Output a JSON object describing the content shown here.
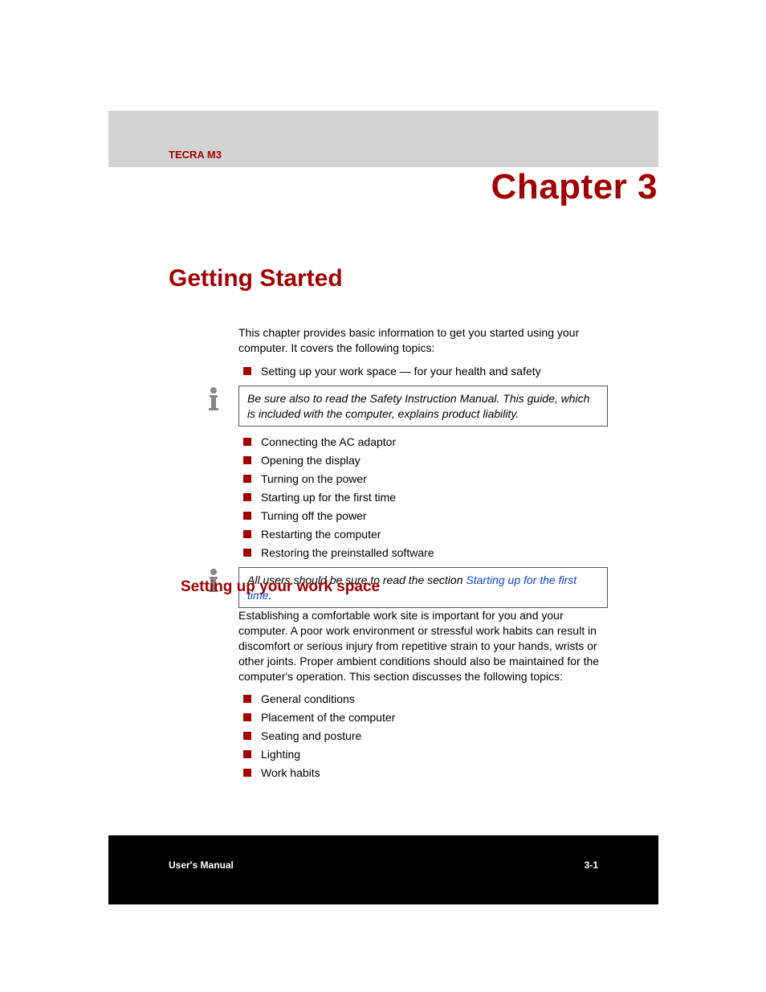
{
  "colors": {
    "accent": "#a00000",
    "link": "#1040e0"
  },
  "header": {
    "product": "TECRA M3"
  },
  "chapter": {
    "title": "Chapter 3"
  },
  "section": {
    "title": "Getting Started"
  },
  "intro": {
    "para": "This chapter provides basic information to get you started using your computer. It covers the following topics:",
    "bullets_top": [
      "Setting up your work space — for your health and safety"
    ],
    "note1": "Be sure also to read the Safety Instruction Manual. This guide, which is included with the computer, explains product liability.",
    "bullets_mid": [
      "Connecting the AC adaptor",
      "Opening the display",
      "Turning on the power",
      "Starting up for the first time",
      "Turning off the power",
      "Restarting the computer",
      "Restoring the preinstalled software"
    ],
    "note2_prefix": "All users should be sure to read the section ",
    "note2_link": "Starting up for the first time",
    "note2_suffix": "."
  },
  "subsection": {
    "heading": "Setting up your work space",
    "para": "Establishing a comfortable work site is important for you and your computer. A poor work environment or stressful work habits can result in discomfort or serious injury from repetitive strain to your hands, wrists or other joints. Proper ambient conditions should also be maintained for the computer's operation. This section discusses the following topics:",
    "bullets": [
      "General conditions",
      "Placement of the computer",
      "Seating and posture",
      "Lighting",
      "Work habits"
    ]
  },
  "footer": {
    "left": "User's Manual",
    "right": "3-1"
  }
}
